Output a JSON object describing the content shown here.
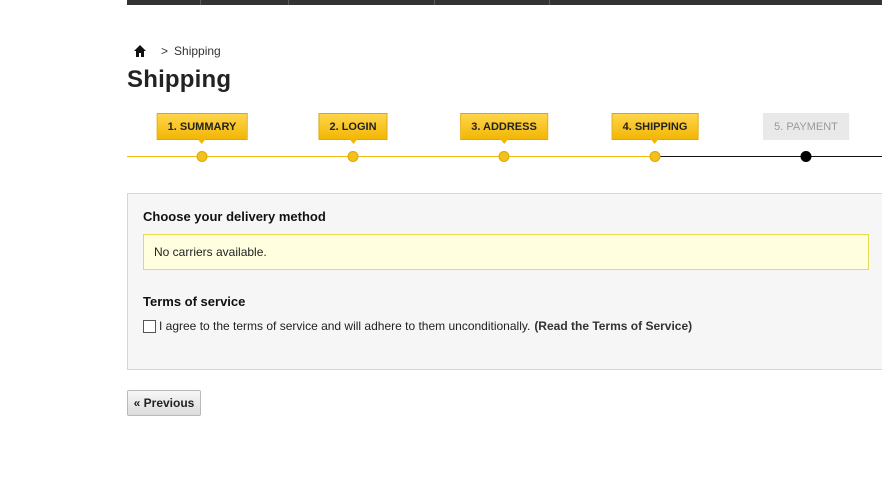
{
  "breadcrumb": {
    "home_icon": "home-icon",
    "separator": ">",
    "current": "Shipping"
  },
  "page": {
    "title": "Shipping"
  },
  "steps": [
    {
      "label": "1. SUMMARY",
      "state": "done"
    },
    {
      "label": "2. LOGIN",
      "state": "done"
    },
    {
      "label": "3. ADDRESS",
      "state": "done"
    },
    {
      "label": "4. SHIPPING",
      "state": "current"
    },
    {
      "label": "5. PAYMENT",
      "state": "todo"
    }
  ],
  "delivery": {
    "heading": "Choose your delivery method",
    "message": "No carriers available."
  },
  "terms": {
    "heading": "Terms of service",
    "checkbox_checked": false,
    "agree_text": "I agree to the terms of service and will adhere to them unconditionally.",
    "link_text": "(Read the Terms of Service)"
  },
  "nav": {
    "previous_label": "« Previous"
  },
  "colors": {
    "accent": "#f2b705",
    "alert_bg": "#ffffe0",
    "alert_border": "#e6db55"
  }
}
